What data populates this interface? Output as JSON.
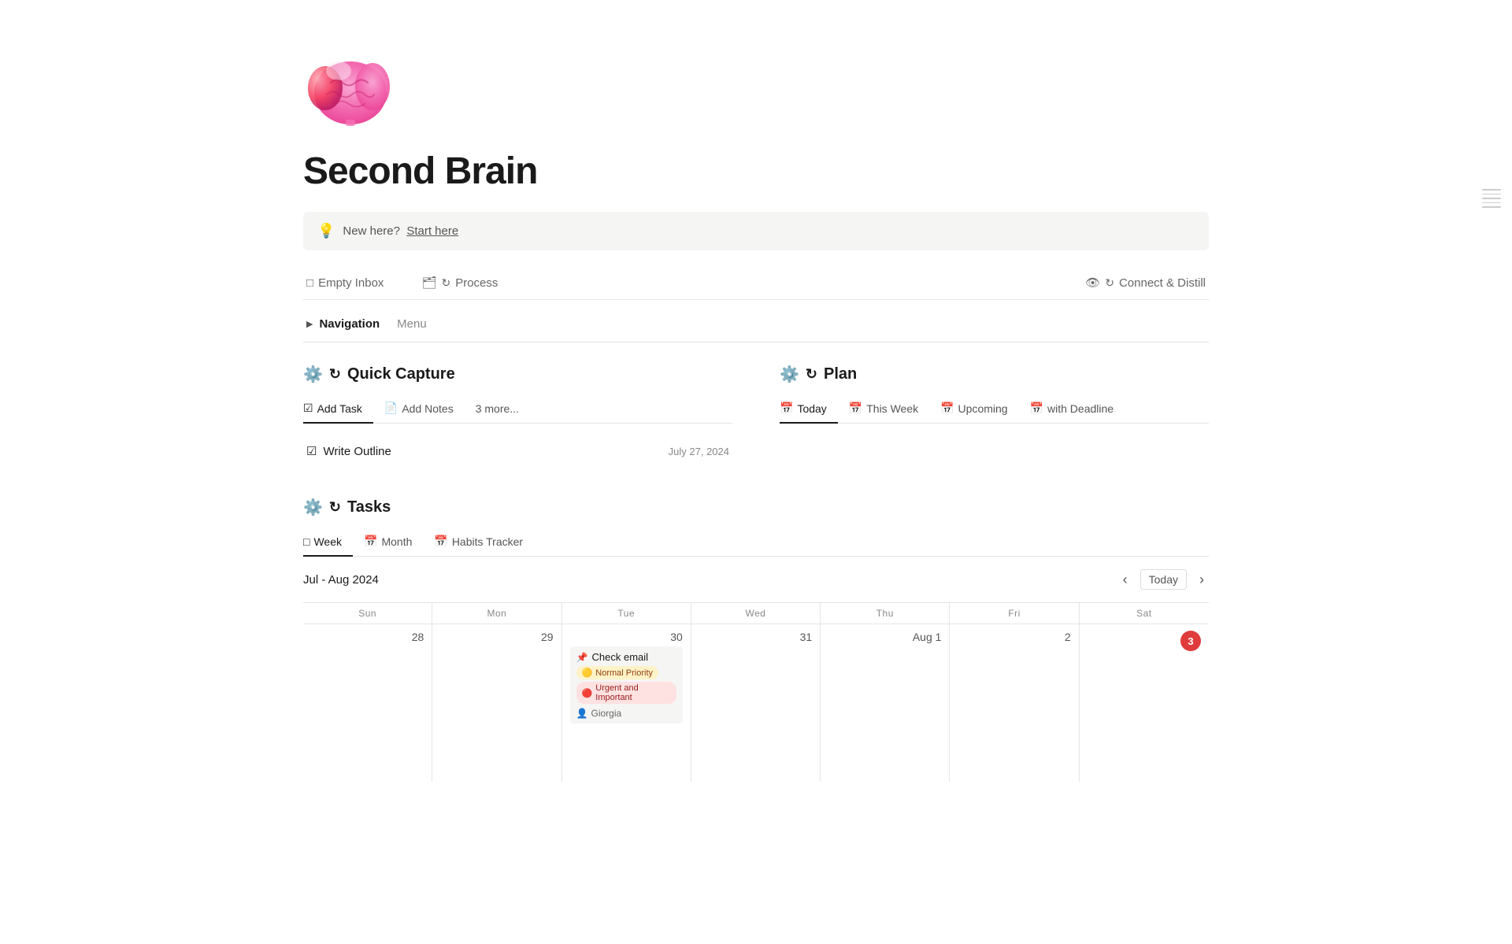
{
  "page": {
    "title": "Second Brain",
    "brain_emoji": "🧠"
  },
  "banner": {
    "icon": "💡",
    "text": "New here?",
    "link_text": "Start here"
  },
  "quick_nav": {
    "items": [
      {
        "id": "empty-inbox",
        "icon": "□",
        "label": "Empty Inbox"
      },
      {
        "id": "process",
        "icon": "🗂",
        "cycle_icon": "↻",
        "label": "Process"
      },
      {
        "id": "connect-distill",
        "icon": "👁",
        "cycle_icon": "↻",
        "label": "Connect & Distill"
      }
    ]
  },
  "navigation_menu": {
    "label": "Navigation",
    "sublabel": "Menu"
  },
  "quick_capture": {
    "section_title": "Quick Capture",
    "section_icons": [
      "⚙",
      "↻"
    ],
    "tabs": [
      {
        "id": "add-task",
        "icon": "☑",
        "label": "Add Task",
        "active": true
      },
      {
        "id": "add-notes",
        "icon": "📄",
        "label": "Add Notes",
        "active": false
      },
      {
        "id": "more",
        "label": "3 more...",
        "active": false
      }
    ],
    "task_item": {
      "icon": "☑",
      "label": "Write Outline",
      "date": "July 27, 2024"
    }
  },
  "plan": {
    "section_title": "Plan",
    "section_icons": [
      "⚙",
      "↻"
    ],
    "tabs": [
      {
        "id": "today",
        "icon": "📅",
        "label": "Today",
        "active": true
      },
      {
        "id": "this-week",
        "icon": "📅",
        "label": "This Week",
        "active": false
      },
      {
        "id": "upcoming",
        "icon": "📅",
        "label": "Upcoming",
        "active": false
      },
      {
        "id": "with-deadline",
        "icon": "📅",
        "label": "with Deadline",
        "active": false
      }
    ]
  },
  "tasks": {
    "section_title": "Tasks",
    "section_icons": [
      "⚙",
      "↻"
    ],
    "tabs": [
      {
        "id": "week",
        "icon": "□",
        "label": "Week",
        "active": true
      },
      {
        "id": "month",
        "icon": "📅",
        "label": "Month",
        "active": false
      },
      {
        "id": "habits-tracker",
        "icon": "📅",
        "label": "Habits Tracker",
        "active": false
      }
    ],
    "date_range": "Jul - Aug 2024",
    "today_button": "Today",
    "nav_prev": "‹",
    "nav_next": "›",
    "calendar": {
      "headers": [
        "Sun",
        "Mon",
        "Tue",
        "Wed",
        "Thu",
        "Fri",
        "Sat"
      ],
      "cells": [
        {
          "date": "28",
          "is_today": false,
          "events": []
        },
        {
          "date": "29",
          "is_today": false,
          "events": []
        },
        {
          "date": "30",
          "is_today": false,
          "events": [
            {
              "title": "Check email",
              "pin_icon": "📌",
              "tags": [
                {
                  "emoji": "🟡",
                  "label": "Normal Priority",
                  "type": "yellow"
                },
                {
                  "emoji": "🔴",
                  "label": "Urgent and Important",
                  "type": "red"
                }
              ],
              "person": "Giorgia",
              "person_icon": "👤"
            }
          ]
        },
        {
          "date": "31",
          "is_today": false,
          "events": []
        },
        {
          "date": "Aug 1",
          "is_today": false,
          "events": []
        },
        {
          "date": "2",
          "is_today": false,
          "events": []
        },
        {
          "date": "3",
          "is_today": true,
          "events": []
        }
      ]
    }
  }
}
